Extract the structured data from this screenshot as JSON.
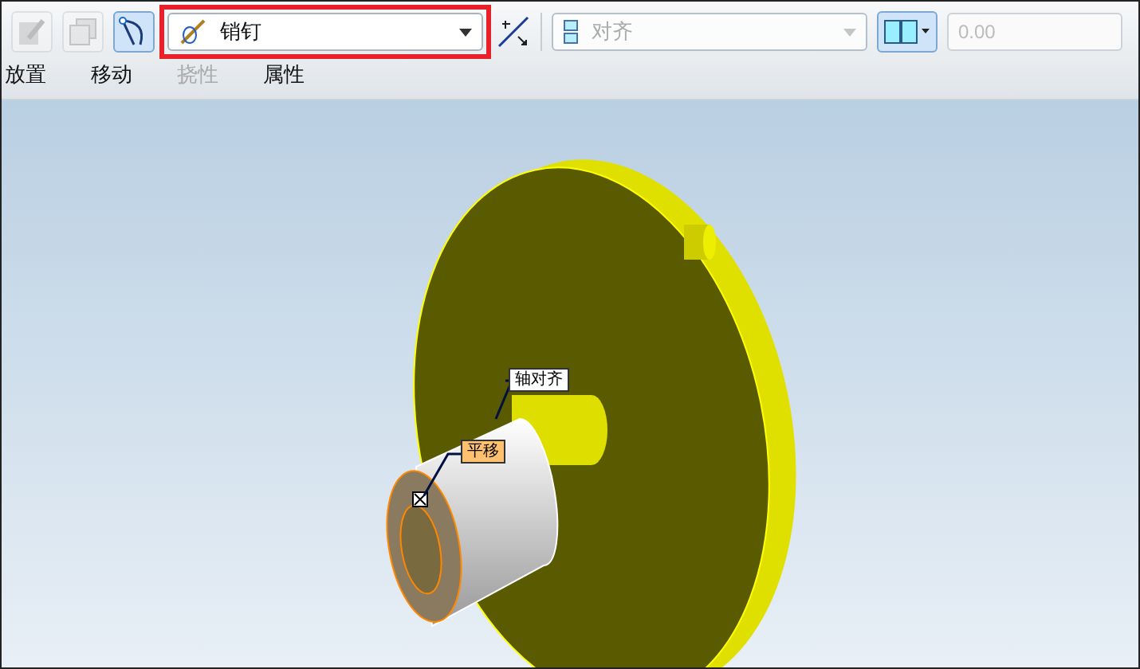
{
  "toolbar": {
    "tools": [
      {
        "kind": "edit",
        "selected": false,
        "disabled": true
      },
      {
        "kind": "copy",
        "selected": false,
        "disabled": true
      },
      {
        "kind": "sketch",
        "selected": true,
        "disabled": false
      }
    ],
    "connection_type": {
      "value": "销钉",
      "highlighted": true
    },
    "constraint": {
      "value": "对齐",
      "disabled": true
    },
    "offset": {
      "placeholder": "0.00",
      "disabled": true
    },
    "tabs": [
      {
        "label": "放置",
        "disabled": false
      },
      {
        "label": "移动",
        "disabled": false
      },
      {
        "label": "挠性",
        "disabled": true
      },
      {
        "label": "属性",
        "disabled": false
      }
    ]
  },
  "model": {
    "labels": [
      {
        "text": "轴对齐",
        "kind": "white"
      },
      {
        "text": "平移",
        "kind": "orange"
      }
    ]
  }
}
